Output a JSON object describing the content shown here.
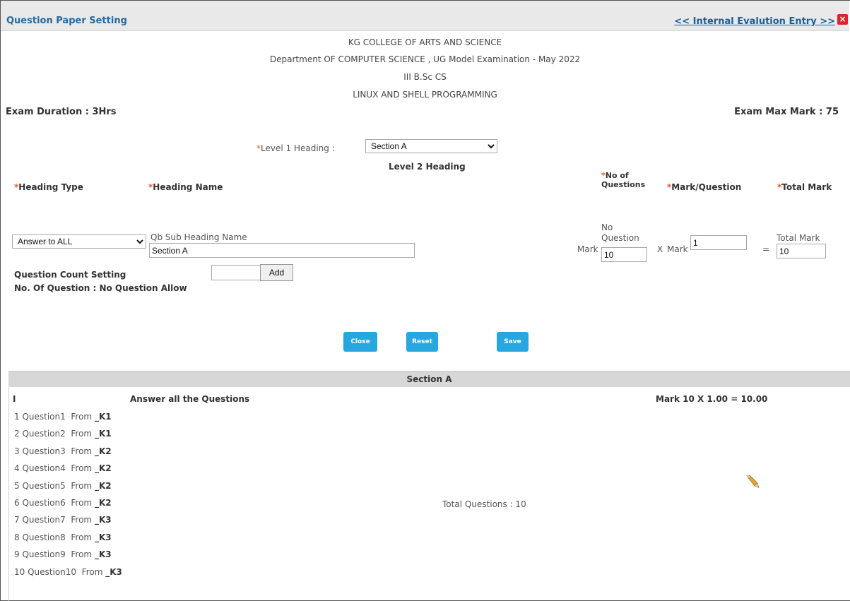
{
  "titlebar": {
    "title": "Question Paper Setting",
    "link": "<< Internal Evalution Entry >>",
    "close": "×"
  },
  "header": {
    "college": "KG COLLEGE OF ARTS AND SCIENCE",
    "department": "Department OF  COMPUTER SCIENCE , UG Model Examination -  May 2022",
    "class": "III B.Sc CS",
    "subject": "LINUX AND SHELL PROGRAMMING",
    "duration": "Exam Duration : 3Hrs",
    "max_mark": "Exam Max Mark : 75"
  },
  "form": {
    "level1_label": "Level 1 Heading  :",
    "level1_value": "Section A",
    "level2_title": "Level 2 Heading",
    "heading_type_label": "Heading Type",
    "heading_name_label": "Heading Name",
    "no_of_questions_label_1": "No of",
    "no_of_questions_label_2": "Questions",
    "mark_question_label": "Mark/Question",
    "total_mark_label": "Total Mark",
    "heading_type_value": "Answer to ALL",
    "qb_sub_heading_label": "Qb Sub Heading Name",
    "heading_name_value": "Section A",
    "mark_prefix": "Mark",
    "no_question_label_1": "No",
    "no_question_label_2": "Question",
    "no_question_value": "10",
    "times": "X",
    "mark_label": "Mark",
    "mark_value": "1",
    "equals": "=",
    "total_mark_field_label": "Total Mark",
    "total_mark_value": "10",
    "question_count_title": "Question Count Setting",
    "no_of_question_label": "No. Of Question : No Question Allow",
    "no_of_question_value": "",
    "add_label": "Add"
  },
  "buttons": {
    "close": "Close",
    "reset": "Reset",
    "save": "Save"
  },
  "section": {
    "title": "Section A",
    "roman": "I",
    "instruction": "Answer all the Questions",
    "mark_formula": "Mark 10  X  1.00  =  10.00",
    "total_questions": "Total Questions : 10",
    "questions": [
      {
        "num": "1",
        "name": "Question1",
        "from": "From",
        "k": "_K1"
      },
      {
        "num": "2",
        "name": "Question2",
        "from": "From",
        "k": "_K1"
      },
      {
        "num": "3",
        "name": "Question3",
        "from": "From",
        "k": "_K2"
      },
      {
        "num": "4",
        "name": "Question4",
        "from": "From",
        "k": "_K2"
      },
      {
        "num": "5",
        "name": "Question5",
        "from": "From",
        "k": "_K2"
      },
      {
        "num": "6",
        "name": "Question6",
        "from": "From",
        "k": "_K2"
      },
      {
        "num": "7",
        "name": "Question7",
        "from": "From",
        "k": "_K3"
      },
      {
        "num": "8",
        "name": "Question8",
        "from": "From",
        "k": "_K3"
      },
      {
        "num": "9",
        "name": "Question9",
        "from": "From",
        "k": "_K3"
      },
      {
        "num": "10",
        "name": "Question10",
        "from": "From",
        "k": "_K3"
      }
    ]
  },
  "colors": {
    "title": "#27679a",
    "button": "#26a7df",
    "required": "#e05a2a",
    "close_icon": "#d9252b"
  },
  "icons": {
    "edit": "pencil-icon",
    "close": "close-icon"
  }
}
